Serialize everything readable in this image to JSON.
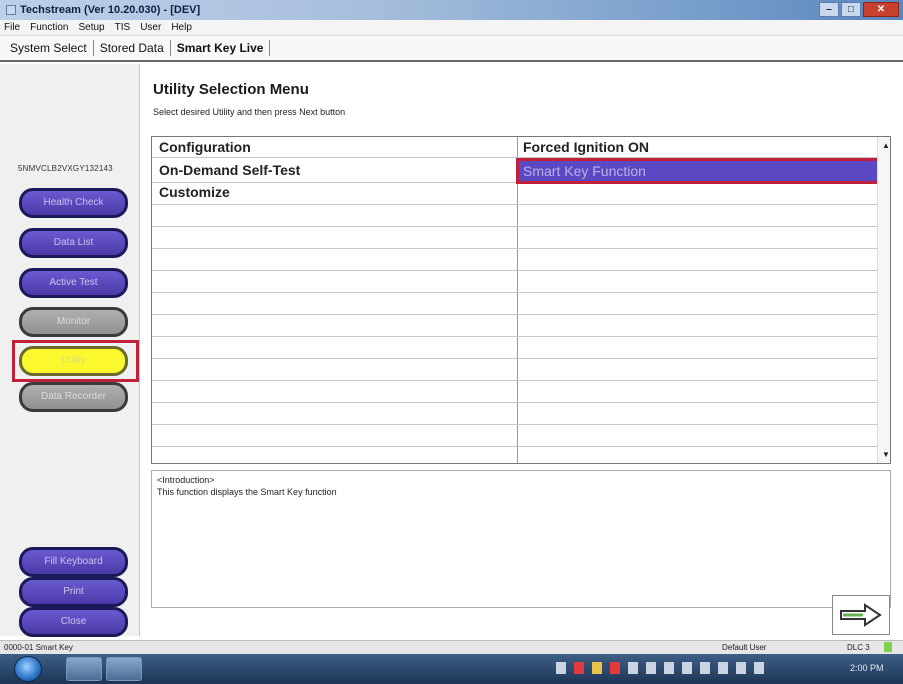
{
  "window": {
    "title": "Techstream (Ver 10.20.030) - [DEV]"
  },
  "menu": {
    "items": [
      "File",
      "Function",
      "Setup",
      "TIS",
      "User",
      "Help"
    ]
  },
  "tabs": [
    "System Select",
    "Stored Data",
    "Smart Key Live"
  ],
  "sidebar": {
    "vin": "5NMVCLB2VXGY132143",
    "buttons": [
      "Health Check",
      "Data List",
      "Active Test",
      "Monitor",
      "Utility",
      "Data Recorder"
    ],
    "bottom_buttons": [
      "Fill Keyboard",
      "Print",
      "Close"
    ]
  },
  "main": {
    "title": "Utility Selection Menu",
    "subtitle": "Select desired Utility and then press Next button",
    "left_items": [
      "Configuration",
      "On-Demand Self-Test",
      "Customize"
    ],
    "right_items": [
      "Forced Ignition ON",
      "Smart Key Function"
    ],
    "intro_tag": "<Introduction>",
    "intro_text": "This function displays the Smart Key function"
  },
  "status": {
    "left": "0000-01 Smart Key",
    "user": "Default User",
    "dlc": "DLC 3"
  },
  "taskbar": {
    "clock": "2:00 PM"
  },
  "colors": {
    "sidebar_button": "#4a3aa8",
    "selected_button": "#fbf830",
    "highlight_row": "#5b49c4",
    "selection_frame": "#c0203a"
  }
}
